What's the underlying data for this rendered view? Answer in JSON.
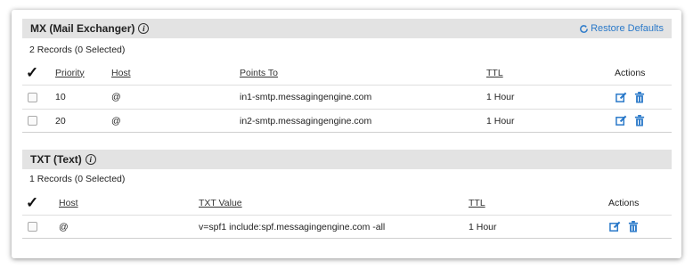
{
  "mx": {
    "title": "MX (Mail Exchanger)",
    "restore_label": "Restore Defaults",
    "records_count": "2 Records (0 Selected)",
    "columns": {
      "priority": "Priority",
      "host": "Host",
      "points_to": "Points To",
      "ttl": "TTL",
      "actions": "Actions"
    },
    "rows": [
      {
        "priority": "10",
        "host": "@",
        "points_to": "in1-smtp.messagingengine.com",
        "ttl": "1 Hour"
      },
      {
        "priority": "20",
        "host": "@",
        "points_to": "in2-smtp.messagingengine.com",
        "ttl": "1 Hour"
      }
    ]
  },
  "txt": {
    "title": "TXT (Text)",
    "records_count": "1 Records (0 Selected)",
    "columns": {
      "host": "Host",
      "value": "TXT Value",
      "ttl": "TTL",
      "actions": "Actions"
    },
    "rows": [
      {
        "host": "@",
        "value": "v=spf1 include:spf.messagingengine.com -all",
        "ttl": "1 Hour"
      }
    ]
  },
  "colors": {
    "accent": "#2a79c9",
    "header_bg": "#e3e3e3"
  },
  "icons": {
    "info": "info-icon",
    "restore": "refresh-icon",
    "edit": "edit-icon",
    "delete": "trash-icon",
    "select_all": "checkmark-icon"
  }
}
